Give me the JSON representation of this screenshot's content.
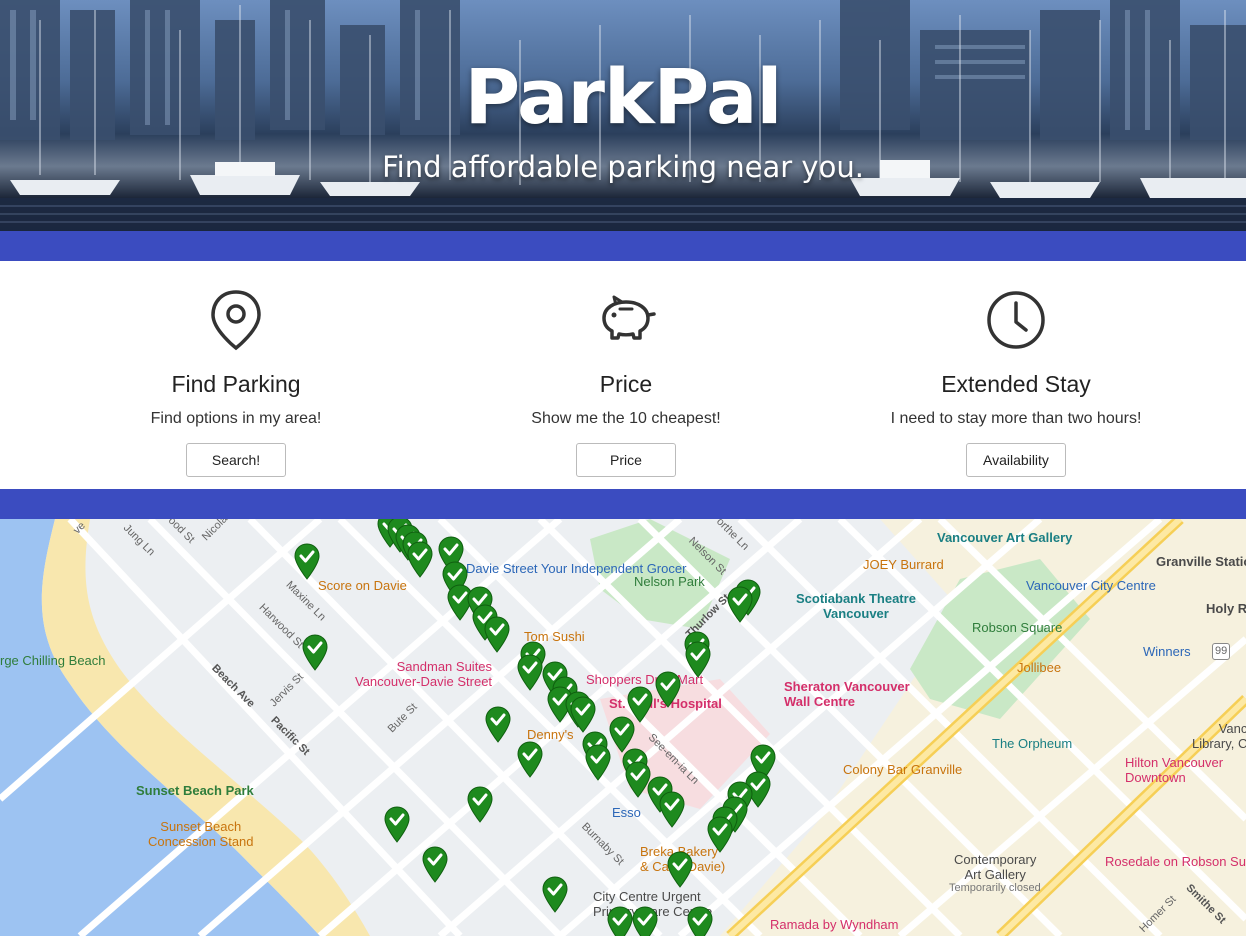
{
  "hero": {
    "title": "ParkPal",
    "subtitle": "Find affordable parking near you."
  },
  "features": [
    {
      "icon": "map-pin-icon",
      "title": "Find Parking",
      "text": "Find options in my area!",
      "button": "Search!"
    },
    {
      "icon": "piggy-bank-icon",
      "title": "Price",
      "text": "Show me the 10 cheapest!",
      "button": "Price"
    },
    {
      "icon": "clock-icon",
      "title": "Extended Stay",
      "text": "I need to stay more than two hours!",
      "button": "Availability"
    }
  ],
  "colors": {
    "band": "#3b4cc0",
    "pin": "#1e8a1e",
    "water": "#9dc3f2",
    "beach": "#f8e7ae",
    "park": "#c9e8c6"
  },
  "map": {
    "places": {
      "davie_grocer": "Davie Street Your\nIndependent Grocer",
      "score_on_davie": "Score on Davie",
      "nelson_park": "Nelson Park",
      "tom_sushi": "Tom Sushi",
      "sandman": "Sandman Suites\nVancouver-Davie Street",
      "shoppers": "Shoppers Drug Mart",
      "st_pauls": "St. Paul's Hospital",
      "dennys": "Denny's",
      "esso": "Esso",
      "breka": "Breka Bakery\n& Café (Davie)",
      "city_centre": "City Centre Urgent\nPrimary Care Centre",
      "ramada": "Ramada by Wyndham",
      "vag": "Vancouver Art Gallery",
      "joey": "JOEY Burrard",
      "granville": "Granville Station",
      "vcc": "Vancouver City Centre",
      "holy": "Holy Ro",
      "scotiabank": "Scotiabank Theatre\nVancouver",
      "robson_square": "Robson Square",
      "winners": "Winners",
      "jollibee": "Jollibee",
      "sheraton": "Sheraton Vancouver\nWall Centre",
      "orpheum": "The Orpheum",
      "library": "Vanc\nLibrary, C",
      "hilton": "Hilton Vancouver\nDowntown",
      "colony": "Colony Bar Granville",
      "contemporary": "Contemporary\nArt Gallery",
      "temp_closed": "Temporarily closed",
      "rosedale": "Rosedale on Robson Su",
      "chilling": "rge Chilling Beach",
      "sunset_park": "Sunset Beach Park",
      "sunset_conc": "Sunset Beach\nConcession Stand"
    },
    "streets": {
      "jung_ln": "Jung Ln",
      "nicola": "Nicola",
      "hood_st": "ood St",
      "ve": "ve",
      "maxine_ln": "Maxine Ln",
      "harwood": "Harwood St",
      "jervis": "Jervis St",
      "beach_ave": "Beach Ave",
      "pacific": "Pacific St",
      "bute": "Bute St",
      "nelson_st": "Nelson St",
      "thurlow": "Thurlow St",
      "burnaby": "Burnaby St",
      "see_em_ia": "See-em-ia Ln",
      "homer": "Homer St",
      "smithe": "Smithe St",
      "northe": "orthe Ln",
      "route": "99"
    }
  }
}
